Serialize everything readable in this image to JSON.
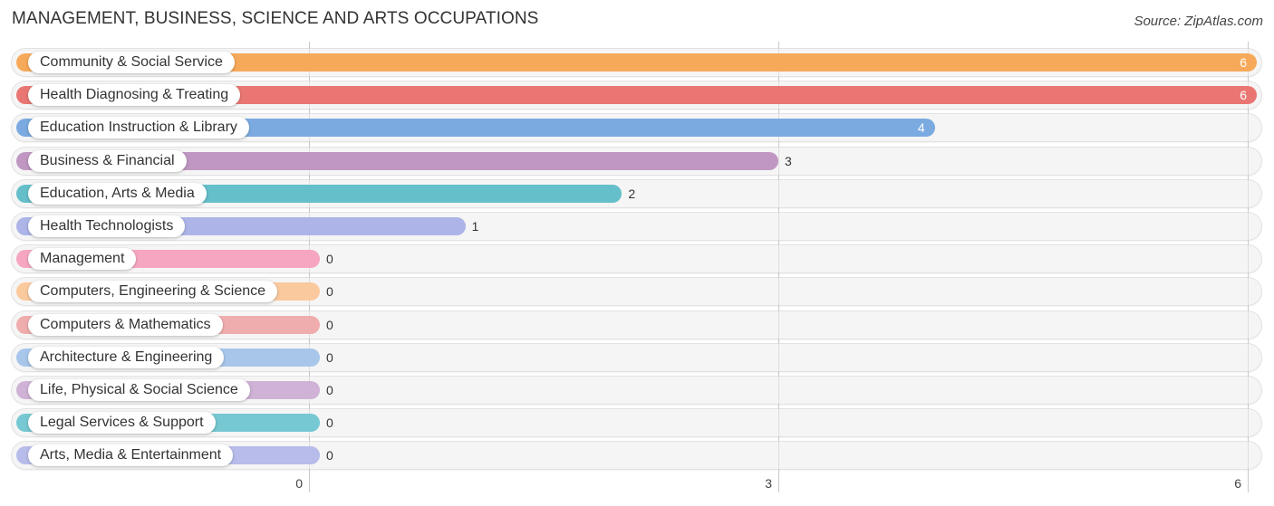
{
  "header": {
    "title": "MANAGEMENT, BUSINESS, SCIENCE AND ARTS OCCUPATIONS",
    "source": "Source: ZipAtlas.com"
  },
  "chart_data": {
    "type": "bar",
    "orientation": "horizontal",
    "title": "MANAGEMENT, BUSINESS, SCIENCE AND ARTS OCCUPATIONS",
    "xlabel": "",
    "ylabel": "",
    "xlim": [
      0,
      6
    ],
    "xticks": [
      "0",
      "3",
      "6"
    ],
    "grid": true,
    "categories": [
      "Community & Social Service",
      "Health Diagnosing & Treating",
      "Education Instruction & Library",
      "Business & Financial",
      "Education, Arts & Media",
      "Health Technologists",
      "Management",
      "Computers, Engineering & Science",
      "Computers & Mathematics",
      "Architecture & Engineering",
      "Life, Physical & Social Science",
      "Legal Services & Support",
      "Arts, Media & Entertainment"
    ],
    "values": [
      6,
      6,
      4,
      3,
      2,
      1,
      0,
      0,
      0,
      0,
      0,
      0,
      0
    ],
    "colors": [
      "#f7a95a",
      "#e97672",
      "#7aaae0",
      "#bf97c2",
      "#65bfca",
      "#acb4e8",
      "#f6a6c0",
      "#fbc99e",
      "#f0adad",
      "#a7c6ea",
      "#cfb2d6",
      "#76c8d2",
      "#b7bcea"
    ]
  }
}
